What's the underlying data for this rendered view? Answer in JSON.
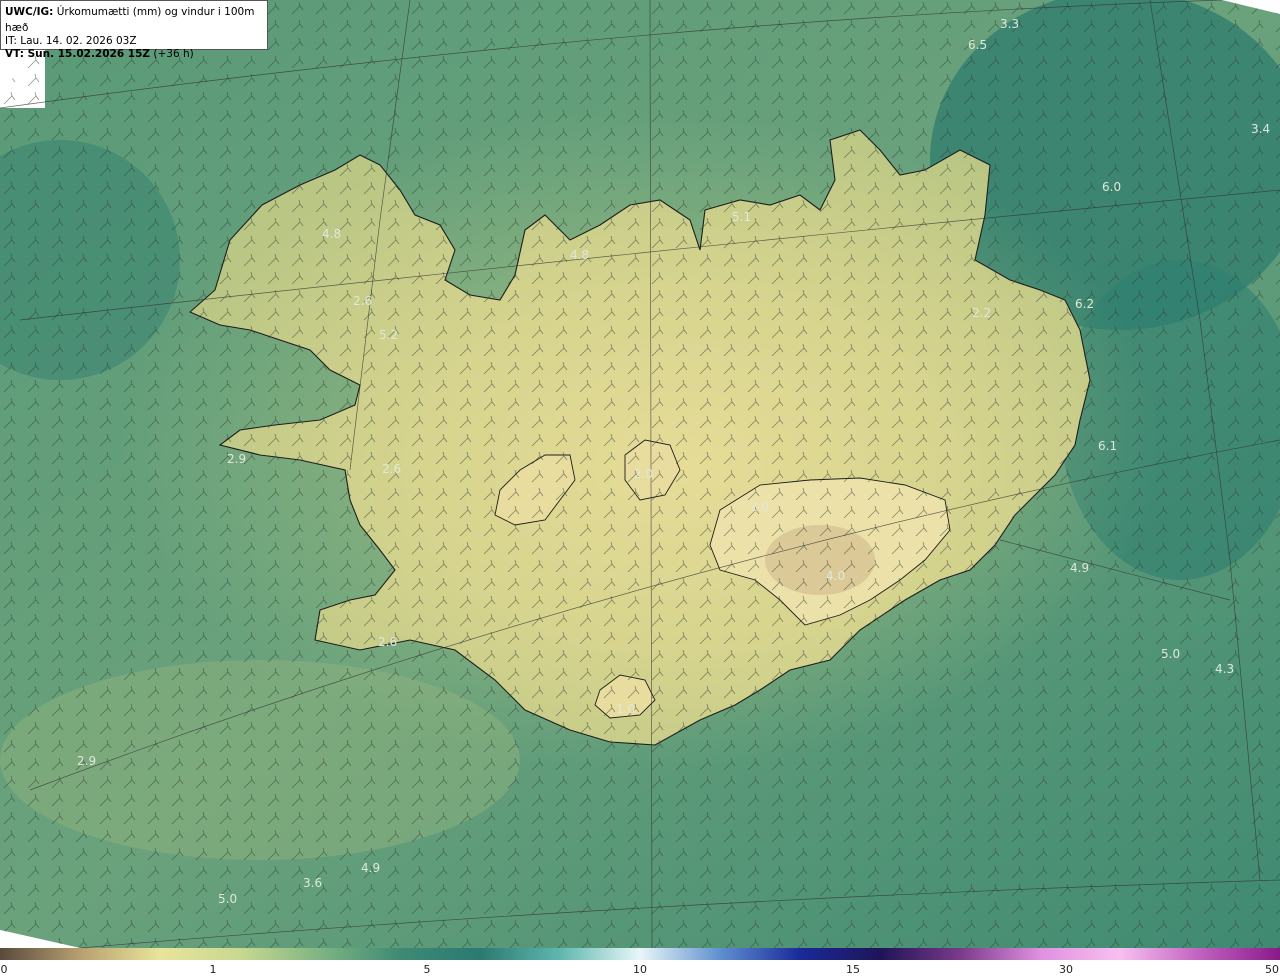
{
  "header": {
    "product_code": "UWC/IG:",
    "product_title": " Úrkomumætti (mm) og vindur i 100m hæð",
    "initial_time": "IT: Lau. 14. 02. 2026 03Z",
    "valid_time_label": "VT: Sun. 15.02.2026 15Z",
    "valid_time_offset": " (+36 h)"
  },
  "colorbar": {
    "ticks": [
      "0",
      "1",
      "5",
      "10",
      "15",
      "30",
      "50"
    ],
    "colors": [
      "#5a4a3c",
      "#b8a070",
      "#e8e49a",
      "#c8d890",
      "#7fb482",
      "#3e8a74",
      "#2b7a72",
      "#5fb8b0",
      "#e8f6f8",
      "#5f8fd0",
      "#1a2a9a",
      "#1f1458",
      "#7a3a8a",
      "#e090e0",
      "#f8c0f0",
      "#c060c0",
      "#8a1a8a"
    ]
  },
  "map": {
    "sea_color": "#3d8a74",
    "land_color": "#d8d48e",
    "value_labels": [
      "3.3",
      "6.5",
      "3.4",
      "6.0",
      "5.1",
      "4.8",
      "4.8",
      "2.6",
      "5.2",
      "6.2",
      "2.2",
      "2.9",
      "2.6",
      "6.1",
      "2.0",
      "2.0",
      "4.9",
      "4.0",
      "2.6",
      "5.0",
      "4.3",
      "1.0",
      "2.9",
      "4.9",
      "3.6",
      "5.0"
    ]
  }
}
